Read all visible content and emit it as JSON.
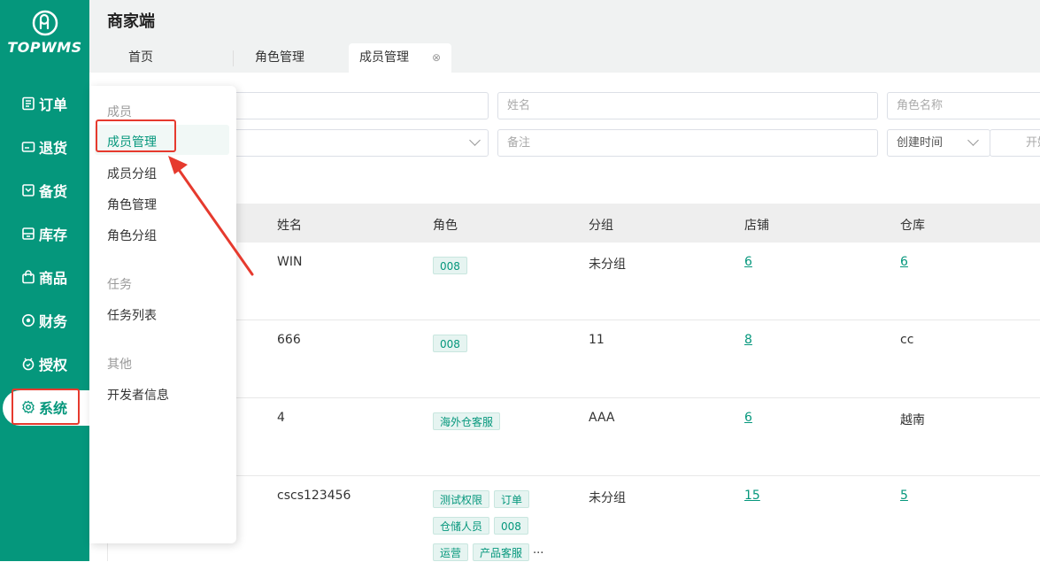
{
  "app": {
    "logo_text": "TOPWMS",
    "page_title": "商家端"
  },
  "nav": {
    "items": [
      {
        "label": "订单",
        "icon": "orders-icon"
      },
      {
        "label": "退货",
        "icon": "returns-icon"
      },
      {
        "label": "备货",
        "icon": "stockup-icon"
      },
      {
        "label": "库存",
        "icon": "inventory-icon"
      },
      {
        "label": "商品",
        "icon": "goods-icon"
      },
      {
        "label": "财务",
        "icon": "finance-icon"
      },
      {
        "label": "授权",
        "icon": "authorize-icon"
      },
      {
        "label": "系统",
        "icon": "gear-icon",
        "active": true
      }
    ]
  },
  "tabs": [
    {
      "label": "首页"
    },
    {
      "label": "角色管理"
    },
    {
      "label": "成员管理",
      "active": true,
      "close": "⊗"
    }
  ],
  "filters": {
    "name_placeholder": "姓名",
    "role_name_placeholder": "角色名称",
    "remark_placeholder": "备注",
    "time_select": "创建时间",
    "start_partial": "开始"
  },
  "table": {
    "headers": {
      "name": "姓名",
      "role": "角色",
      "group": "分组",
      "store": "店铺",
      "warehouse": "仓库"
    },
    "rows": [
      {
        "name": "WIN",
        "roles": [
          "008"
        ],
        "group": "未分组",
        "store": "6",
        "warehouse": "6"
      },
      {
        "name": "666",
        "roles": [
          "008"
        ],
        "group": "11",
        "store": "8",
        "warehouse": "cc"
      },
      {
        "name": "4",
        "roles": [
          "海外仓客服"
        ],
        "group": "AAA",
        "store": "6",
        "warehouse": "越南"
      },
      {
        "name": "cscs123456",
        "roles": [
          "测试权限",
          "订单",
          "仓储人员",
          "008",
          "运营",
          "产品客服"
        ],
        "more": "...",
        "group": "未分组",
        "store": "15",
        "warehouse": "5"
      }
    ]
  },
  "menu": {
    "group1": "成员",
    "member_manage": "成员管理",
    "member_group": "成员分组",
    "role_manage": "角色管理",
    "role_group": "角色分组",
    "group2": "任务",
    "task_list": "任务列表",
    "group3": "其他",
    "dev_info": "开发者信息"
  },
  "colors": {
    "brand": "#05977c",
    "highlight": "#e63a2e"
  }
}
